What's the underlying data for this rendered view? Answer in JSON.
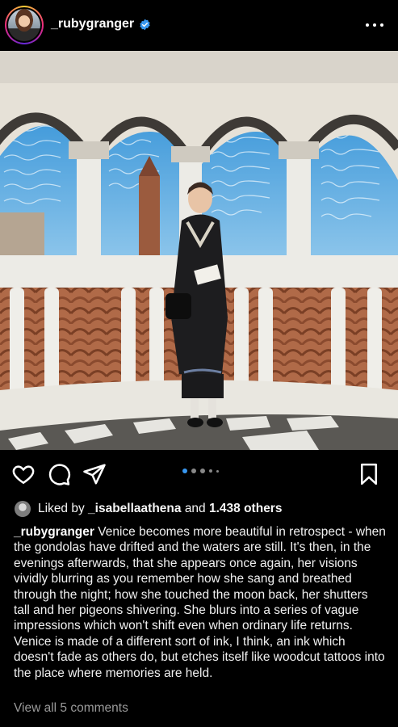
{
  "post": {
    "username": "_rubygranger",
    "verified": true,
    "liked_prefix": "Liked by",
    "liked_user": "_isabellaathena",
    "liked_and": "and",
    "liked_count": "1.438 others",
    "caption_user": "_rubygranger",
    "caption_text": " Venice becomes more beautiful in retrospect - when the gondolas have drifted and the waters are still. It's then, in the evenings afterwards, that she appears once again, her visions vividly blurring as you remember how she sang and breathed through the night; how she touched the moon back, her shutters tall and her pigeons shivering. She blurs into a series of vague impressions which won't shift even when ordinary life returns. Venice is made of a different sort of ink, I think, an ink which doesn't fade as others do, but etches itself like woodcut tattoos into the place where memories are held.",
    "view_comments": "View all 5 comments",
    "carousel": {
      "count": 5,
      "active": 1
    }
  },
  "icons": {
    "like": "heart-icon",
    "comment": "comment-icon",
    "share": "send-icon",
    "save": "bookmark-icon",
    "more": "more-icon",
    "verified": "verified-badge-icon"
  },
  "colors": {
    "background": "#000000",
    "text": "#f5f5f5",
    "muted": "#9a9a9a",
    "accent": "#3897f0"
  }
}
